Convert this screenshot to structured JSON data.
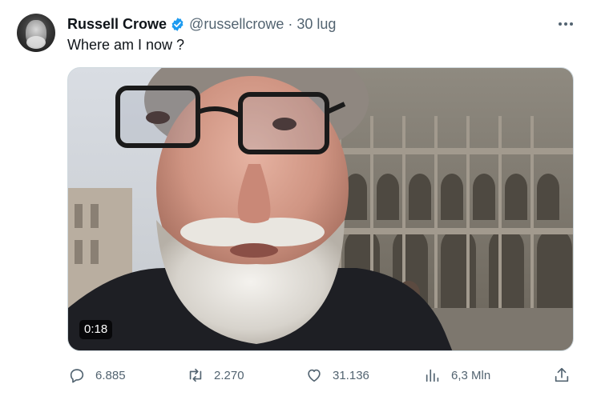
{
  "tweet": {
    "author_name": "Russell Crowe",
    "handle": "@russellcrowe",
    "separator": "·",
    "time": "30 lug",
    "text": "Where am I now ?"
  },
  "media": {
    "duration": "0:18"
  },
  "actions": {
    "replies": "6.885",
    "reposts": "2.270",
    "likes": "31.136",
    "views": "6,3 Mln"
  },
  "colors": {
    "verified": "#1d9bf0",
    "secondary_text": "#536471",
    "primary_text": "#0f1419"
  },
  "icons": [
    "verified-badge-icon",
    "more-icon",
    "reply-icon",
    "repost-icon",
    "like-icon",
    "views-icon",
    "share-icon"
  ]
}
